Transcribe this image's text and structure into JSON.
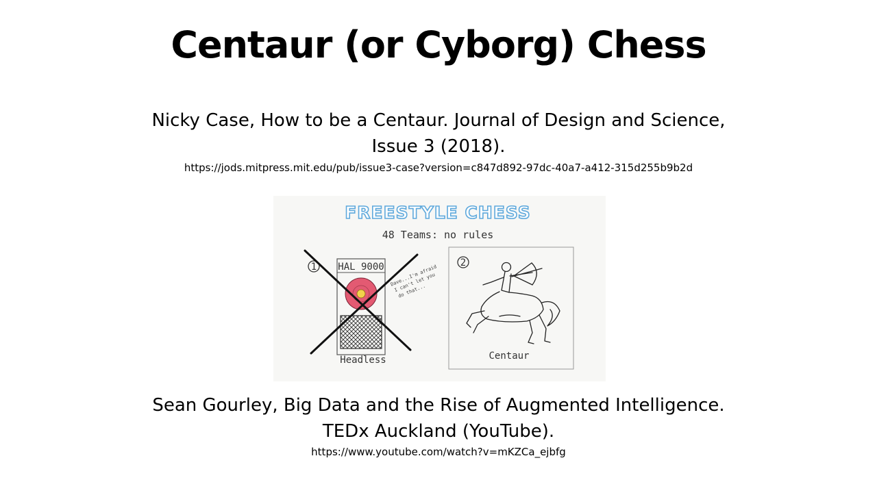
{
  "slide": {
    "title": "Centaur (or Cyborg) Chess"
  },
  "citation1": {
    "line1": "Nicky Case, How to be a Centaur. Journal of Design and Science,",
    "line2": "Issue 3 (2018).",
    "url": "https://jods.mitpress.mit.edu/pub/issue3-case?version=c847d892-97dc-40a7-a412-315d255b9b2d"
  },
  "illustration": {
    "heading": "FREESTYLE CHESS",
    "subheading": "48 Teams: no rules",
    "panel1": {
      "number": "1",
      "machine_label": "HAL 9000",
      "speech": [
        "Dave...I'm afraid",
        "I can't let you",
        "do that..."
      ],
      "caption": "Headless"
    },
    "panel2": {
      "number": "2",
      "caption": "Centaur"
    },
    "colors": {
      "heading": "#5fa9dc",
      "hal_eye_outer": "#e35a72",
      "hal_eye_inner": "#f2d24b",
      "cross": "#111111"
    }
  },
  "citation2": {
    "line1": "Sean Gourley, Big Data and the Rise of Augmented Intelligence.",
    "line2": "TEDx Auckland (YouTube).",
    "url": "https://www.youtube.com/watch?v=mKZCa_ejbfg"
  }
}
